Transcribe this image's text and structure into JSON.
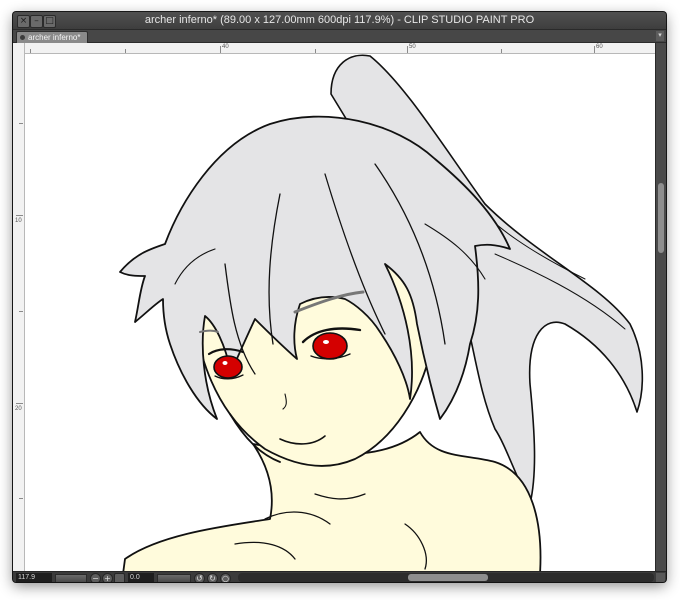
{
  "window": {
    "title": "archer inferno* (89.00 x 127.00mm 600dpi 117.9%)  - CLIP STUDIO PAINT PRO",
    "close_glyph": "×",
    "minimize_glyph": "–",
    "maximize_glyph": "□"
  },
  "tabs": [
    {
      "label": "archer inferno*",
      "active": true
    }
  ],
  "tab_scroll_glyph": "▾",
  "rulers": {
    "horizontal_labels": [
      "40",
      "50",
      "60"
    ],
    "vertical_labels": [
      "10",
      "20"
    ]
  },
  "canvas": {
    "artwork": "character-illustration",
    "colors": {
      "skin": "#fffbdc",
      "hair": "#e4e4e6",
      "eyes": "#d40000",
      "lineart": "#111111"
    }
  },
  "statusbar": {
    "zoom_value": "117.9",
    "zoom_out_glyph": "−",
    "zoom_in_glyph": "+",
    "angle_value": "0.0",
    "rotate_left_glyph": "↺",
    "rotate_right_glyph": "↻",
    "reset_glyph": "○"
  },
  "icons": [
    "close-icon",
    "minimize-icon",
    "maximize-icon",
    "zoom-out-icon",
    "zoom-in-icon",
    "rotate-left-icon",
    "rotate-right-icon",
    "reset-icon"
  ]
}
